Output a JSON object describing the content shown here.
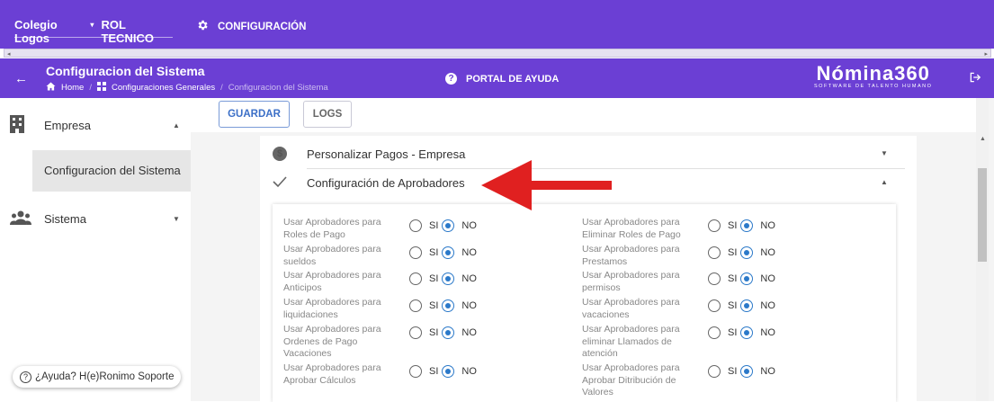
{
  "topbar": {
    "company": "Colegio Logos",
    "role": "ROL TECNICO",
    "config_label": "CONFIGURACIÓN"
  },
  "header": {
    "title": "Configuracion del Sistema",
    "breadcrumbs": [
      "Home",
      "Configuraciones Generales",
      "Configuracion del Sistema"
    ],
    "help_label": "PORTAL DE AYUDA",
    "logo_main": "Nómina360",
    "logo_sub": "SOFTWARE DE TALENTO HUMANO"
  },
  "sidebar": {
    "items": [
      {
        "label": "Empresa"
      },
      {
        "label": "Configuracion del Sistema"
      },
      {
        "label": "Sistema"
      }
    ],
    "help_chip": "¿Ayuda? H(e)Ronimo Soporte"
  },
  "toolbar": {
    "save_label": "GUARDAR",
    "logs_label": "LOGS"
  },
  "accordion": {
    "pagos": "Personalizar Pagos - Empresa",
    "aprobadores": "Configuración de Aprobadores"
  },
  "options_left": [
    {
      "text": "Usar Aprobadores para Roles de Pago",
      "selected": "NO"
    },
    {
      "text": "Usar Aprobadores para sueldos",
      "selected": "NO"
    },
    {
      "text": "Usar Aprobadores para Anticipos",
      "selected": "NO"
    },
    {
      "text": "Usar Aprobadores para liquidaciones",
      "selected": "NO"
    },
    {
      "text": "Usar Aprobadores para Ordenes de Pago Vacaciones",
      "selected": "NO"
    },
    {
      "text": "Usar Aprobadores para Aprobar Cálculos",
      "selected": "NO"
    }
  ],
  "options_right": [
    {
      "text": "Usar Aprobadores para Eliminar Roles de Pago",
      "selected": "NO"
    },
    {
      "text": "Usar Aprobadores para Prestamos",
      "selected": "NO"
    },
    {
      "text": "Usar Aprobadores para permisos",
      "selected": "NO"
    },
    {
      "text": "Usar Aprobadores para vacaciones",
      "selected": "NO"
    },
    {
      "text": "Usar Aprobadores para eliminar Llamados de atención",
      "selected": "NO"
    },
    {
      "text": "Usar Aprobadores para Aprobar Ditribución de Valores",
      "selected": "NO"
    }
  ],
  "radio_labels": {
    "si": "SI",
    "no": "NO"
  },
  "colors": {
    "primary": "#6b3fd4",
    "radio": "#2b79c9",
    "arrow": "#e02020"
  }
}
